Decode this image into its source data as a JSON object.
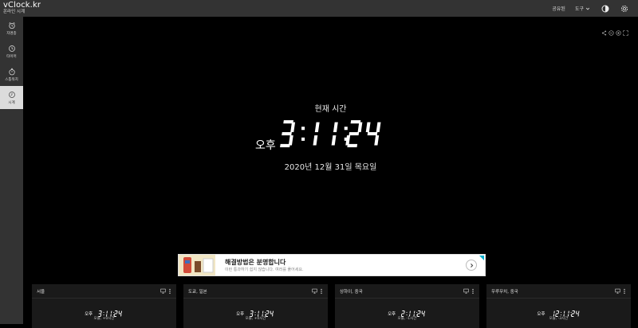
{
  "header": {
    "logo_title": "vClock.kr",
    "logo_subtitle": "온라인 시계",
    "share_label": "공유된",
    "tools_label": "도구",
    "icons": [
      "contrast-icon",
      "gear-icon"
    ]
  },
  "sidebar": {
    "items": [
      {
        "label": "자명종",
        "icon": "alarm-clock-icon",
        "active": false
      },
      {
        "label": "타이머",
        "icon": "timer-icon",
        "active": false
      },
      {
        "label": "스톱워치",
        "icon": "stopwatch-icon",
        "active": false
      },
      {
        "label": "시계",
        "icon": "clock-icon",
        "active": true
      }
    ]
  },
  "main": {
    "now_label": "현재 시간",
    "ampm": "오후",
    "time": "3:11:24",
    "date": "2020년 12월 31일 목요일",
    "tools": [
      "share-icon",
      "zoom-out-icon",
      "zoom-in-icon",
      "fullscreen-icon"
    ]
  },
  "ad": {
    "title": "해결방법은 분명합니다",
    "subtitle": "이런 통과하기 쉽지 않습니다. 여러를 풀어세요."
  },
  "cities": [
    {
      "name": "서울",
      "ampm": "오후",
      "time": "3:11:24",
      "offset": "오늘, +0시간"
    },
    {
      "name": "도쿄, 일본",
      "ampm": "오후",
      "time": "3:11:24",
      "offset": "오늘, +0시간"
    },
    {
      "name": "상하이, 중국",
      "ampm": "오후",
      "time": "2:11:24",
      "offset": "오늘, -1시간"
    },
    {
      "name": "우루무치, 중국",
      "ampm": "오후",
      "time": "12:11:24",
      "offset": "오늘, -3시간"
    }
  ],
  "colors": {
    "sidebar_bg": "#333333",
    "sidebar_active": "#dcdcdc",
    "page_bg": "#000000",
    "card_bg": "#1a1a1a",
    "text": "#ffffff"
  }
}
